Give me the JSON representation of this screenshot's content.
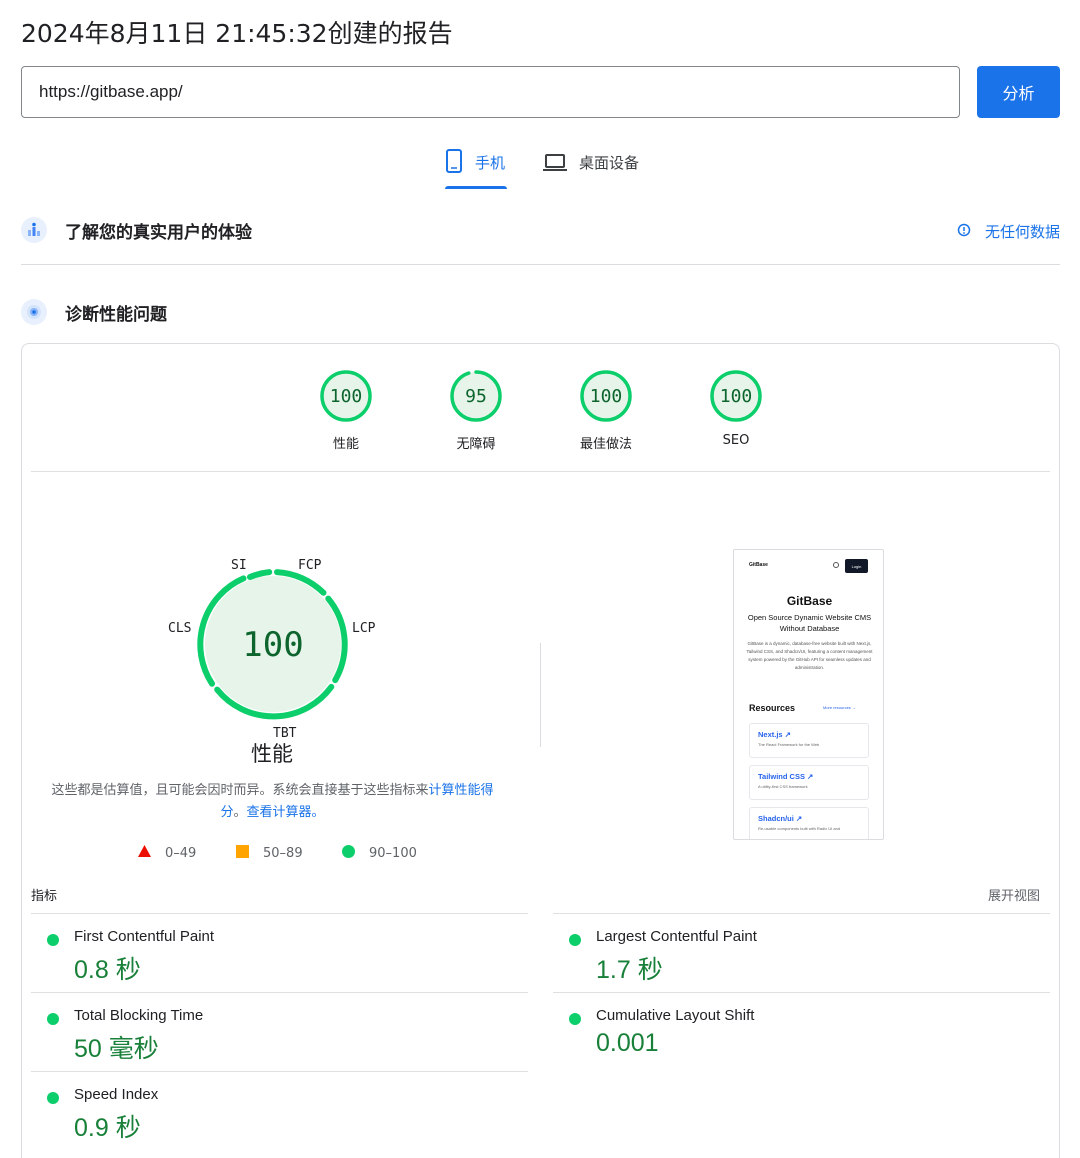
{
  "header": {
    "title": "2024年8月11日 21:45:32创建的报告",
    "url_value": "https://gitbase.app/",
    "analyze_label": "分析"
  },
  "tabs": [
    {
      "label": "手机",
      "icon": "smartphone-icon",
      "selected": true
    },
    {
      "label": "桌面设备",
      "icon": "laptop-icon",
      "selected": false
    }
  ],
  "crux": {
    "title": "了解您的真实用户的体验",
    "icon": "users-chart-icon",
    "no_data_label": "无任何数据",
    "no_data_icon": "info-icon"
  },
  "diagnose": {
    "title": "诊断性能问题",
    "icon": "lighthouse-icon"
  },
  "category_scores": [
    {
      "label": "性能",
      "score": "100",
      "value": 100
    },
    {
      "label": "无障碍",
      "score": "95",
      "value": 95
    },
    {
      "label": "最佳做法",
      "score": "100",
      "value": 100
    },
    {
      "label": "SEO",
      "score": "100",
      "value": 100
    }
  ],
  "performance": {
    "score": "100",
    "label": "性能",
    "metric_tags": [
      "SI",
      "FCP",
      "LCP",
      "TBT",
      "CLS"
    ],
    "note_text": "这些都是估算值，且可能会因时而异。系统会直接基于这些指标来",
    "note_link": "计算性能得分",
    "note_sep": "。",
    "calc_link": "查看计算器。",
    "legend": [
      {
        "shape": "triangle",
        "range": "0–49",
        "color": "#ff4e42"
      },
      {
        "shape": "square",
        "range": "50–89",
        "color": "#ffa400"
      },
      {
        "shape": "circle",
        "range": "90–100",
        "color": "#0cce6b"
      }
    ]
  },
  "screenshot": {
    "brand": "GitBase",
    "login": "Login",
    "heading": "GitBase",
    "subheading": "Open Source Dynamic Website CMS Without Database",
    "description": "GitBase is a dynamic, database-free website built with Next.js, Tailwind CSS, and Shadcn/UI, featuring a content management system powered by the GitHub API for seamless updates and administration.",
    "resources_title": "Resources",
    "more_link": "More resources →",
    "items": [
      {
        "title": "Next.js ↗",
        "desc": "The React Framework for the Web"
      },
      {
        "title": "Tailwind CSS ↗",
        "desc": "A utility-first CSS framework"
      },
      {
        "title": "Shadcn/ui ↗",
        "desc": "Re-usable components built with Radix UI and"
      }
    ]
  },
  "metrics": {
    "header": "指标",
    "expand_label": "展开视图",
    "items": [
      {
        "name": "First Contentful Paint",
        "value": "0.8 秒",
        "color": "#0cce6b"
      },
      {
        "name": "Largest Contentful Paint",
        "value": "1.7 秒",
        "color": "#0cce6b"
      },
      {
        "name": "Total Blocking Time",
        "value": "50 毫秒",
        "color": "#0cce6b"
      },
      {
        "name": "Cumulative Layout Shift",
        "value": "0.001",
        "color": "#0cce6b"
      },
      {
        "name": "Speed Index",
        "value": "0.9 秒",
        "color": "#0cce6b"
      }
    ]
  },
  "colors": {
    "accent": "#1a73e8",
    "pass": "#0cce6b",
    "pass_text": "#188038",
    "pass_fill": "#e6f4ea"
  }
}
